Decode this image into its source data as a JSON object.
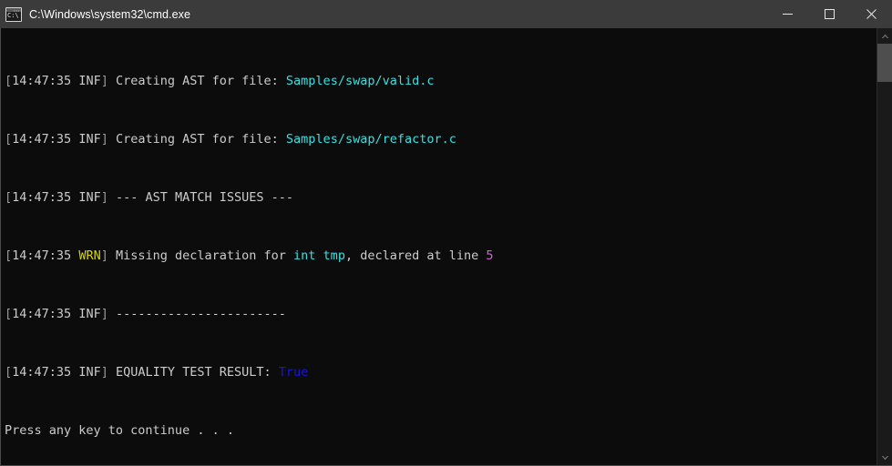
{
  "window": {
    "title": "C:\\Windows\\system32\\cmd.exe",
    "icon": "cmd-console-icon",
    "icon_prompt_text": "C:\\",
    "titlebar_color": "#3b3b3b",
    "console_bg": "#0c0c0c"
  },
  "window_controls": {
    "minimize_label": "Minimize",
    "maximize_label": "Maximize",
    "close_label": "Close"
  },
  "colors": {
    "gray": "#9a9a9a",
    "white": "#cccccc",
    "cyan": "#3ae0e0",
    "yellow": "#d7d700",
    "magenta": "#d760d7",
    "blue": "#1a14e0"
  },
  "console": {
    "lines": [
      {
        "id": "log-line-1",
        "bracket_open": "[",
        "timestamp": "14:47:35",
        "level": "INF",
        "bracket_close": "]",
        "message_pre": " Creating AST for file: ",
        "highlight": "Samples/swap/valid.c",
        "message_post": ""
      },
      {
        "id": "log-line-2",
        "bracket_open": "[",
        "timestamp": "14:47:35",
        "level": "INF",
        "bracket_close": "]",
        "message_pre": " Creating AST for file: ",
        "highlight": "Samples/swap/refactor.c",
        "message_post": ""
      },
      {
        "id": "log-line-3",
        "bracket_open": "[",
        "timestamp": "14:47:35",
        "level": "INF",
        "bracket_close": "]",
        "message_pre": " --- AST MATCH ISSUES ---",
        "highlight": "",
        "message_post": ""
      },
      {
        "id": "log-line-4",
        "bracket_open": "[",
        "timestamp": "14:47:35",
        "level": "WRN",
        "bracket_close": "]",
        "message_pre": " Missing declaration for ",
        "highlight": "int tmp",
        "message_post": ", declared at line ",
        "tail": "5"
      },
      {
        "id": "log-line-5",
        "bracket_open": "[",
        "timestamp": "14:47:35",
        "level": "INF",
        "bracket_close": "]",
        "message_pre": " -----------------------",
        "highlight": "",
        "message_post": ""
      },
      {
        "id": "log-line-6",
        "bracket_open": "[",
        "timestamp": "14:47:35",
        "level": "INF",
        "bracket_close": "]",
        "message_pre": " EQUALITY TEST RESULT: ",
        "highlight": "True",
        "message_post": ""
      }
    ],
    "prompt_line": "Press any key to continue . . ."
  },
  "scrollbar": {
    "up_arrow": "▲",
    "down_arrow": "▼",
    "thumb_label": "scroll-thumb"
  }
}
